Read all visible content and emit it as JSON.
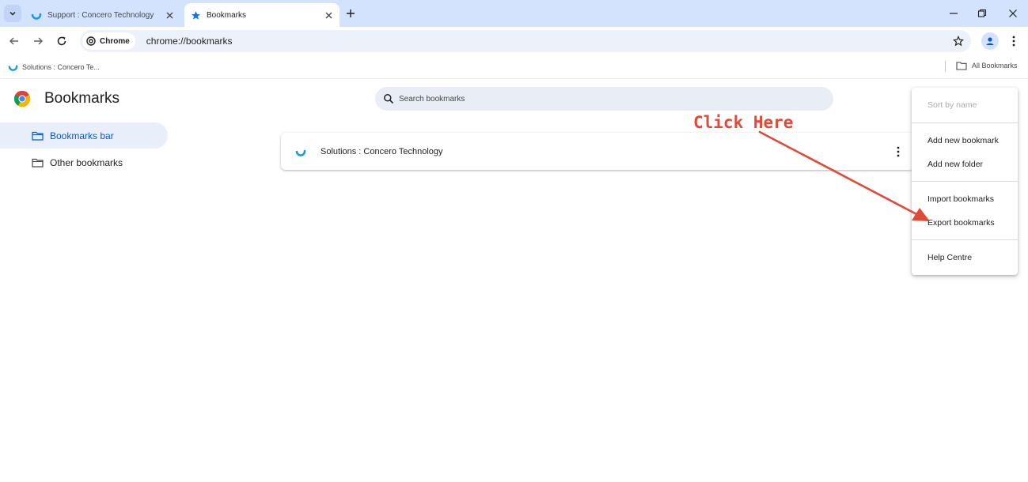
{
  "tabs": [
    {
      "label": "Support : Concero Technology",
      "active": false
    },
    {
      "label": "Bookmarks",
      "active": true
    }
  ],
  "omnibox": {
    "chip_label": "Chrome",
    "url": "chrome://bookmarks"
  },
  "bookmarks_bar": {
    "items": [
      {
        "label": "Solutions : Concero Te..."
      }
    ],
    "all_bookmarks_label": "All Bookmarks"
  },
  "page": {
    "title": "Bookmarks",
    "search_placeholder": "Search bookmarks"
  },
  "sidebar": {
    "items": [
      {
        "label": "Bookmarks bar",
        "selected": true
      },
      {
        "label": "Other bookmarks",
        "selected": false
      }
    ]
  },
  "bookmark_list": [
    {
      "title": "Solutions : Concero Technology"
    }
  ],
  "menu": {
    "items": [
      {
        "label": "Sort by name",
        "disabled": true
      },
      {
        "label": "Add new bookmark"
      },
      {
        "label": "Add new folder"
      },
      {
        "label": "Import bookmarks"
      },
      {
        "label": "Export bookmarks"
      },
      {
        "label": "Help Centre"
      }
    ]
  },
  "annotation": {
    "text": "Click Here",
    "color": "#e04a38"
  },
  "colors": {
    "accent": "#0b57d0",
    "tabstrip": "#d3e3fd",
    "favicon": "#1a73e8"
  },
  "icons": {
    "tab_favicon_1": "concero-logo-icon",
    "tab_favicon_2": "star-icon",
    "search": "search-icon",
    "folder": "folder-icon"
  }
}
